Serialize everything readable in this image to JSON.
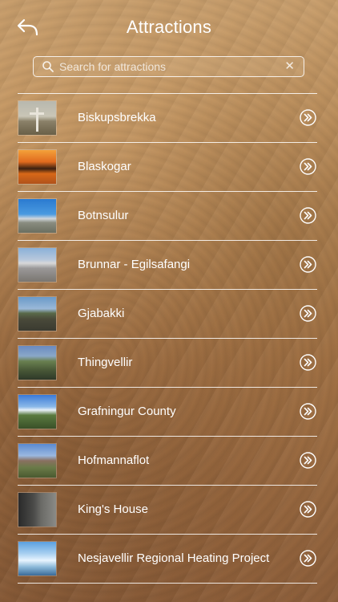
{
  "header": {
    "title": "Attractions",
    "back_icon": "back-arrow-icon"
  },
  "search": {
    "placeholder": "Search for attractions",
    "value": "",
    "icon": "search-icon",
    "clear_icon": "close-icon"
  },
  "attractions": [
    {
      "label": "Biskupsbrekka",
      "thumb": "thumbnail-1"
    },
    {
      "label": "Blaskogar",
      "thumb": "thumbnail-2"
    },
    {
      "label": "Botnsulur",
      "thumb": "thumbnail-3"
    },
    {
      "label": "Brunnar - Egilsafangi",
      "thumb": "thumbnail-4"
    },
    {
      "label": "Gjabakki",
      "thumb": "thumbnail-5"
    },
    {
      "label": "Thingvellir",
      "thumb": "thumbnail-6"
    },
    {
      "label": "Grafningur County",
      "thumb": "thumbnail-7"
    },
    {
      "label": "Hofmannaflot",
      "thumb": "thumbnail-8"
    },
    {
      "label": "King's House",
      "thumb": "thumbnail-9"
    },
    {
      "label": "Nesjavellir Regional Heating Project",
      "thumb": "thumbnail-10"
    }
  ],
  "row_arrow_icon": "double-chevron-right-circle-icon",
  "colors": {
    "text": "#ffffff",
    "divider": "#ffffff",
    "background_top": "#c89e6c",
    "background_bottom": "#8e603c"
  }
}
